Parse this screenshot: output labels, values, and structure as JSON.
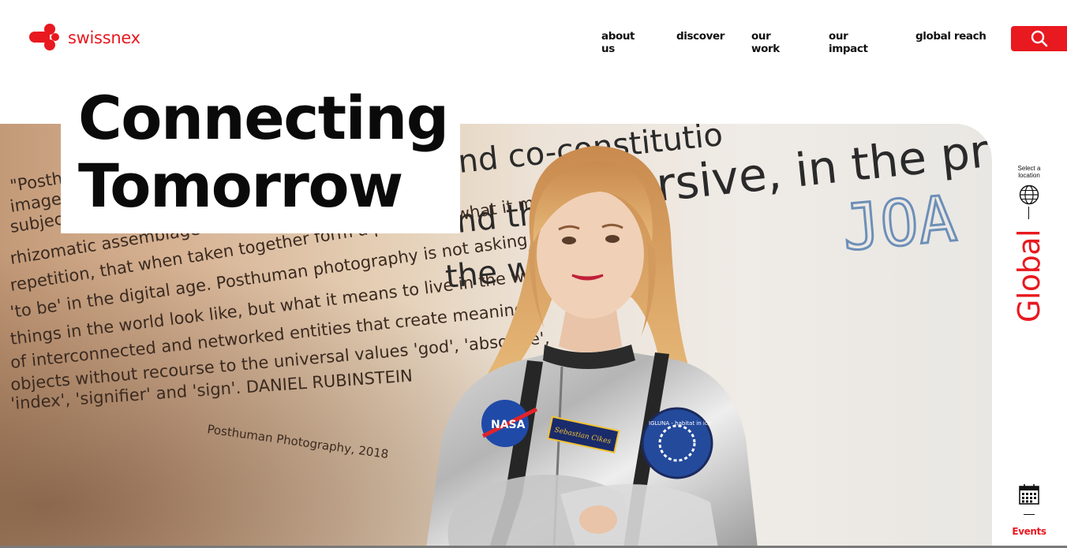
{
  "brand": {
    "name": "swissnex",
    "accent_color": "#e8191f"
  },
  "nav": {
    "items": [
      {
        "label": "about us"
      },
      {
        "label": "discover"
      },
      {
        "label": "our work"
      },
      {
        "label": "our impact"
      },
      {
        "label": "global reach"
      }
    ],
    "search_icon": "search-icon"
  },
  "hero": {
    "title_line1": "Connecting",
    "title_line2": "Tomorrow",
    "wall_text_right": [
      "nd co-constitutio",
      "nd th",
      "rsive, in the pr",
      "the wo"
    ],
    "wall_logo": "JOA",
    "wall_text_left": [
      "\"Posthuman pho",
      "image that is bas",
      "subject-object",
      "rhizomatic assemblage of interconnected fragme",
      "repetition, that when taken together form a picture of what it means",
      "'to be' in the digital age. Posthuman photography is not asking what",
      "things in the world look like, but what it means to live in the world",
      "of interconnected and networked entities that create meaningful",
      "objects without recourse to the universal values 'god', 'absolute',",
      "'index', 'signifier' and 'sign'. DANIEL RUBINSTEIN",
      "Posthuman Photography, 2018"
    ],
    "patch_left": "NASA",
    "name_tag": "Sebastian Cikes",
    "patch_right": "IGLUNA - habitat in ice"
  },
  "rail": {
    "location_prompt_line1": "Select a",
    "location_prompt_line2": "location",
    "globe_icon": "globe-icon",
    "current_location": "Global",
    "events_icon": "calendar-icon",
    "events_label": "Events"
  }
}
